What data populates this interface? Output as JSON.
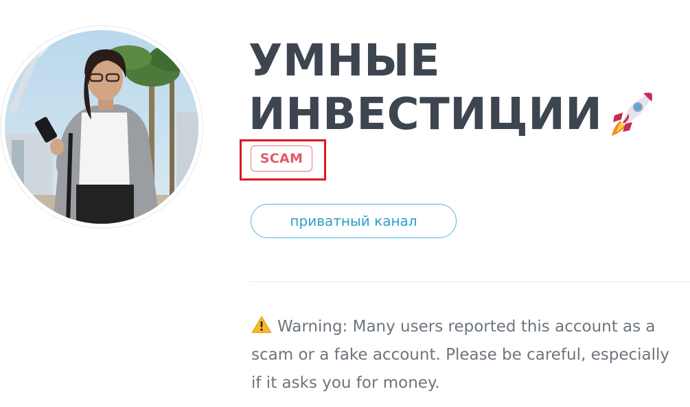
{
  "channel": {
    "title_line1": "УМНЫЕ",
    "title_line2": "ИНВЕСТИЦИИ",
    "title_emoji": "rocket-icon",
    "badge": "SCAM",
    "private_label": "приватный канал"
  },
  "warning": {
    "icon": "warning-icon",
    "text": "Warning: Many users reported this account as a scam or a fake account. Please be careful, especially if it asks you for money."
  },
  "colors": {
    "title": "#3d4650",
    "badge": "#e05a63",
    "highlight": "#e0141b",
    "button": "#2b9fc9",
    "warning_text": "#6c757d"
  }
}
